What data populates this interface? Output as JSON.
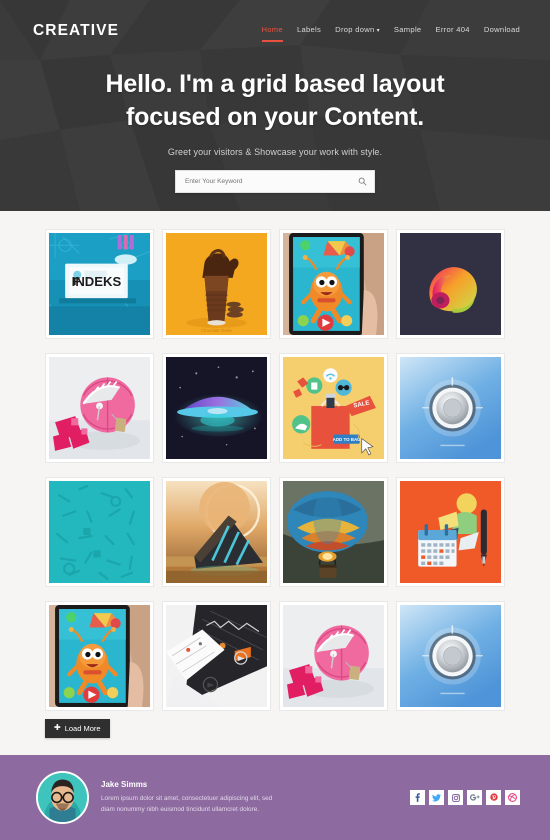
{
  "header": {
    "brand": "CREATIVE",
    "nav": [
      {
        "label": "Home",
        "active": true,
        "caret": false
      },
      {
        "label": "Labels",
        "active": false,
        "caret": false
      },
      {
        "label": "Drop down",
        "active": false,
        "caret": true
      },
      {
        "label": "Sample",
        "active": false,
        "caret": false
      },
      {
        "label": "Error 404",
        "active": false,
        "caret": false
      },
      {
        "label": "Download",
        "active": false,
        "caret": false
      }
    ],
    "title_line1": "Hello. I'm a grid based layout",
    "title_line2": "focused on your Content.",
    "subtitle": "Greet your visitors & Showcase your work with style.",
    "search_placeholder": "Enter Your Keyword",
    "search_value": "",
    "search_icon": "search-icon",
    "accent_color": "#e8513f",
    "background_color": "#3b3b3b"
  },
  "gallery": {
    "items": [
      {
        "name": "findeks-presentation",
        "art": "findeks",
        "alt": "FINDEKS screen presentation"
      },
      {
        "name": "chocolate-shake",
        "art": "shake",
        "alt": "Chocolate shake splash"
      },
      {
        "name": "mobile-game-character",
        "art": "game",
        "alt": "Mobile game character on tablet"
      },
      {
        "name": "colorful-curl",
        "art": "curl",
        "alt": "Colorful paper curl"
      },
      {
        "name": "pink-basketball",
        "art": "basketball",
        "alt": "Pink zipped basketball"
      },
      {
        "name": "ufo-night",
        "art": "ufo",
        "alt": "Glowing UFO at night"
      },
      {
        "name": "shopping-bag-sale",
        "art": "shopping",
        "alt": "Shopping bag with sale tag"
      },
      {
        "name": "metal-dial-knob",
        "art": "dial",
        "alt": "Metal dial knob on blue"
      },
      {
        "name": "teal-icon-pattern",
        "art": "pattern",
        "alt": "Teal tools pattern"
      },
      {
        "name": "desert-monolith",
        "art": "monolith",
        "alt": "Desert monolith with moon"
      },
      {
        "name": "hot-air-balloon",
        "art": "balloon",
        "alt": "Hot air balloon burner"
      },
      {
        "name": "calendar-pen-flat",
        "art": "calendar",
        "alt": "Flat calendar and pen illustration"
      },
      {
        "name": "mobile-game-character-2",
        "art": "game",
        "alt": "Mobile game character on tablet"
      },
      {
        "name": "dark-ui-screens",
        "art": "uiscreens",
        "alt": "Dark app UI screens perspective"
      },
      {
        "name": "pink-basketball-2",
        "art": "basketball",
        "alt": "Pink zipped basketball"
      },
      {
        "name": "metal-dial-knob-2",
        "art": "dial",
        "alt": "Metal dial knob on blue"
      }
    ],
    "load_more_label": "Load More",
    "load_more_icon": "plus-icon",
    "background_color": "#f6f5f3"
  },
  "footer": {
    "author_name": "Jake Simms",
    "author_bio": "Lorem ipsum dolor sit amet, consectetuer adipiscing elit, sed diam nonummy nibh euismod tincidunt ullamcret dolore.",
    "avatar_icon": "avatar",
    "background_color": "#8d6ba0",
    "socials": [
      {
        "name": "facebook-icon",
        "glyph": "f",
        "color": "#3b5998"
      },
      {
        "name": "twitter-icon",
        "glyph": "t",
        "color": "#3fa9f5"
      },
      {
        "name": "instagram-icon",
        "glyph": "i",
        "color": "#8a70a8"
      },
      {
        "name": "google-plus-icon",
        "glyph": "g+",
        "color": "#6d7a8c"
      },
      {
        "name": "pinterest-icon",
        "glyph": "p",
        "color": "#e0393e"
      },
      {
        "name": "dribbble-icon",
        "glyph": "d",
        "color": "#ea4c89"
      }
    ]
  }
}
